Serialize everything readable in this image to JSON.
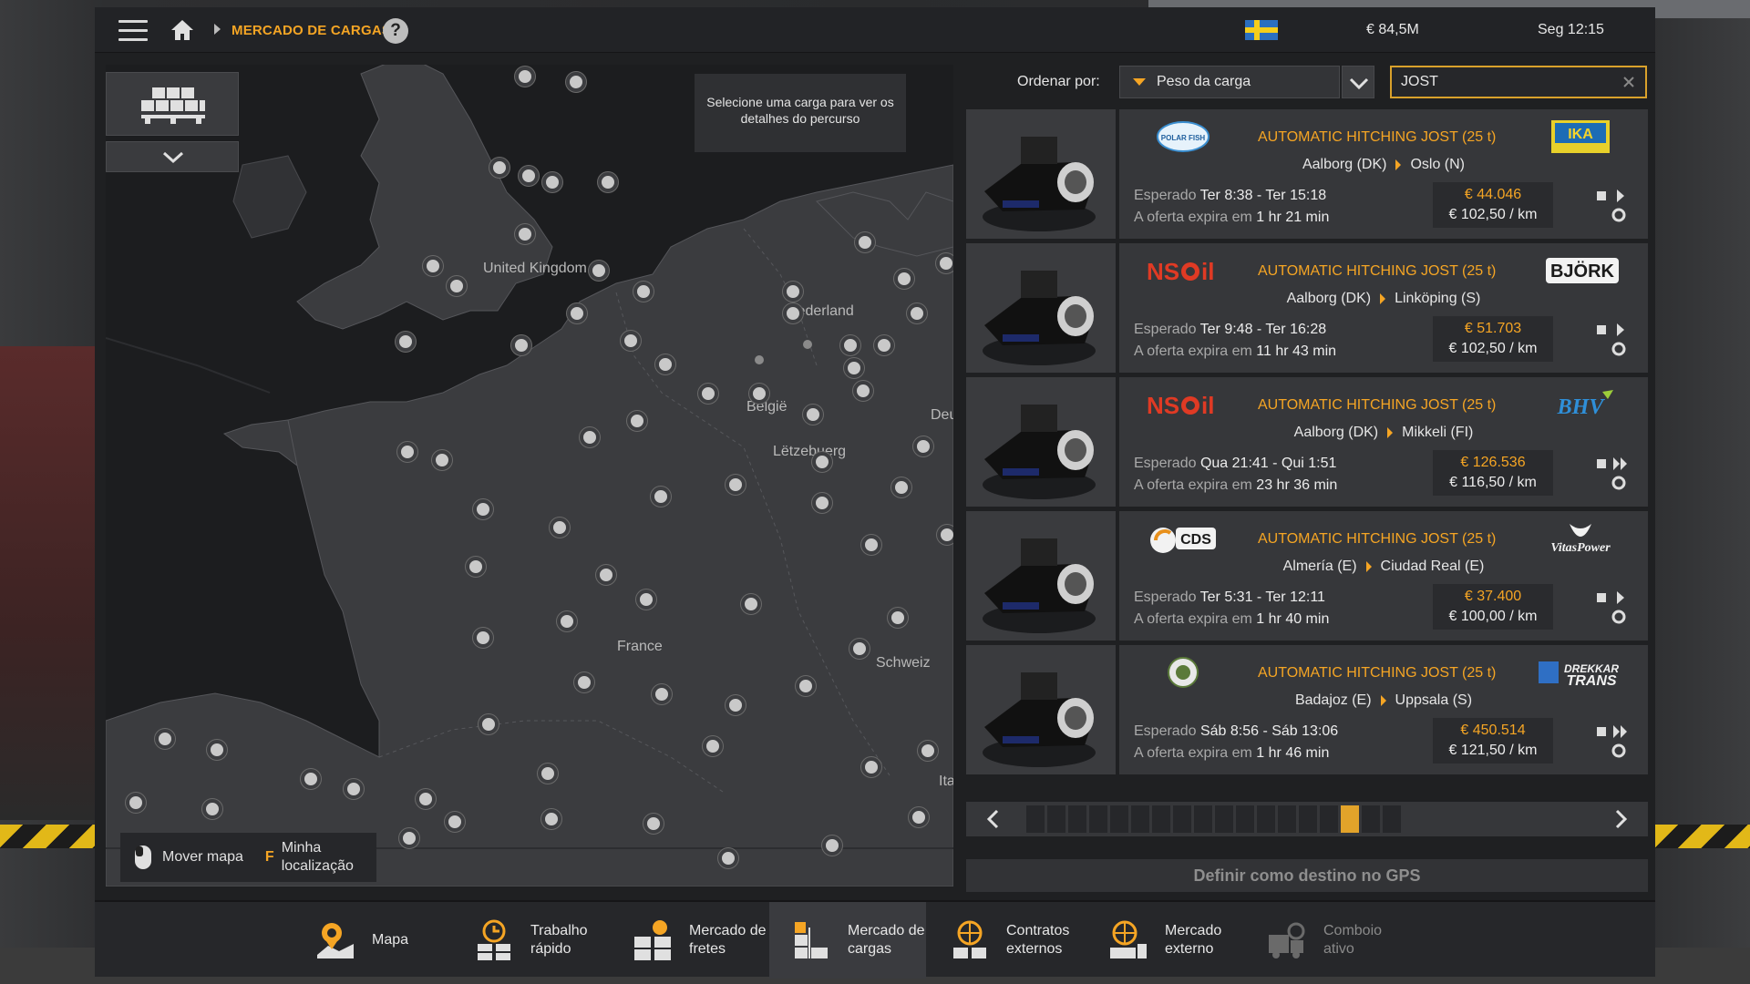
{
  "topbar": {
    "breadcrumb": "MERCADO DE CARGAS",
    "help": "?",
    "money": "€ 84,5M",
    "time": "Seg 12:15"
  },
  "map": {
    "tooltip": "Selecione uma carga para ver os detalhes do percurso",
    "labels": [
      "United Kingdom",
      "Nederland",
      "België",
      "Lëtzebuerg",
      "France",
      "Schweiz",
      "Deu",
      "Ita"
    ],
    "hint_move": "Mover mapa",
    "hint_key": "F",
    "hint_location": "Minha localização"
  },
  "sort": {
    "label": "Ordenar por:",
    "selected": "Peso da carga"
  },
  "search": {
    "value": "JOST"
  },
  "jobs": [
    {
      "logo_left": "POLAR FISH",
      "logo_right": "IKA",
      "title": "AUTOMATIC HITCHING JOST (25 t)",
      "origin": "Aalborg (DK)",
      "destination": "Oslo (N)",
      "expected_label": "Esperado",
      "expected": "Ter 8:38 - Ter 15:18",
      "offer_label": "A oferta expira em",
      "offer": "1 hr 21 min",
      "price": "€ 44.046",
      "per_km": "€ 102,50 / km"
    },
    {
      "logo_left": "NSOil",
      "logo_right": "BJÖRK",
      "title": "AUTOMATIC HITCHING JOST (25 t)",
      "origin": "Aalborg (DK)",
      "destination": "Linköping (S)",
      "expected_label": "Esperado",
      "expected": "Ter 9:48 - Ter 16:28",
      "offer_label": "A oferta expira em",
      "offer": "11 hr 43 min",
      "price": "€ 51.703",
      "per_km": "€ 102,50 / km"
    },
    {
      "logo_left": "NSOil",
      "logo_right": "BHV",
      "title": "AUTOMATIC HITCHING JOST (25 t)",
      "origin": "Aalborg (DK)",
      "destination": "Mikkeli (FI)",
      "expected_label": "Esperado",
      "expected": "Qua 21:41 - Qui 1:51",
      "offer_label": "A oferta expira em",
      "offer": "23 hr 36 min",
      "price": "€ 126.536",
      "per_km": "€ 116,50 / km"
    },
    {
      "logo_left": "CDS",
      "logo_right": "VitasPower",
      "title": "AUTOMATIC HITCHING JOST (25 t)",
      "origin": "Almería (E)",
      "destination": "Ciudad Real (E)",
      "expected_label": "Esperado",
      "expected": "Ter 5:31 - Ter 12:11",
      "offer_label": "A oferta expira em",
      "offer": "1 hr 40 min",
      "price": "€ 37.400",
      "per_km": "€ 100,00 / km"
    },
    {
      "logo_left": "",
      "logo_right": "DREKKAR TRANS",
      "title": "AUTOMATIC HITCHING JOST (25 t)",
      "origin": "Badajoz (E)",
      "destination": "Uppsala (S)",
      "expected_label": "Esperado",
      "expected": "Sáb 8:56 - Sáb 13:06",
      "offer_label": "A oferta expira em",
      "offer": "1 hr 46 min",
      "price": "€ 450.514",
      "per_km": "€ 121,50 / km"
    }
  ],
  "pager": {
    "total_pages": 18,
    "current_page": 16
  },
  "gps_button": "Definir como destino no GPS",
  "bottom_nav": [
    {
      "label": "Mapa",
      "icon": "map-pin-icon"
    },
    {
      "label": "Trabalho rápido",
      "icon": "clock-cargo-icon"
    },
    {
      "label": "Mercado de fretes",
      "icon": "freight-boxes-icon"
    },
    {
      "label": "Mercado de cargas",
      "icon": "cargo-market-icon",
      "active": true
    },
    {
      "label": "Contratos externos",
      "icon": "globe-contract-icon"
    },
    {
      "label": "Mercado externo",
      "icon": "globe-truck-icon"
    },
    {
      "label": "Comboio ativo",
      "icon": "convoy-icon",
      "disabled": true
    }
  ],
  "colors": {
    "accent": "#f5a524",
    "panel": "#36373a",
    "background": "#1f2022"
  }
}
